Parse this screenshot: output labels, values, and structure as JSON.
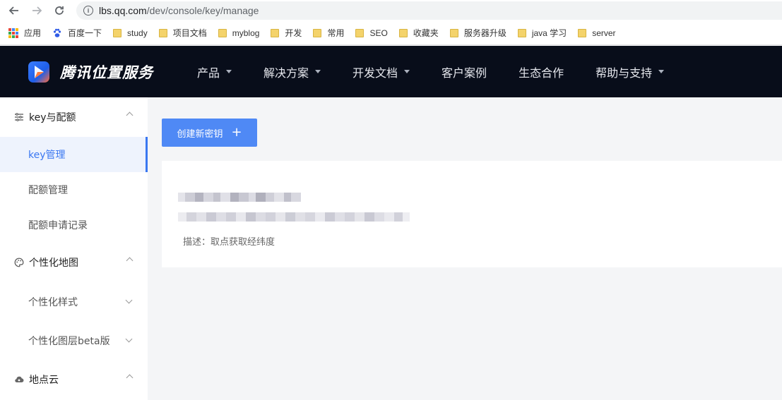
{
  "browser": {
    "url_host": "lbs.qq.com",
    "url_path": "/dev/console/key/manage",
    "bookmarks": [
      {
        "label": "应用",
        "icon": "apps-grid-icon"
      },
      {
        "label": "百度一下",
        "icon": "baidu-icon"
      },
      {
        "label": "study",
        "icon": "folder-icon"
      },
      {
        "label": "项目文档",
        "icon": "folder-icon"
      },
      {
        "label": "myblog",
        "icon": "folder-icon"
      },
      {
        "label": "开发",
        "icon": "folder-icon"
      },
      {
        "label": "常用",
        "icon": "folder-icon"
      },
      {
        "label": "SEO",
        "icon": "folder-icon"
      },
      {
        "label": "收藏夹",
        "icon": "folder-icon"
      },
      {
        "label": "服务器升级",
        "icon": "folder-icon"
      },
      {
        "label": "java 学习",
        "icon": "folder-icon"
      },
      {
        "label": "server",
        "icon": "folder-icon"
      }
    ]
  },
  "header": {
    "brand": "腾讯位置服务",
    "nav": [
      {
        "label": "产品",
        "dropdown": true
      },
      {
        "label": "解决方案",
        "dropdown": true
      },
      {
        "label": "开发文档",
        "dropdown": true
      },
      {
        "label": "客户案例",
        "dropdown": false
      },
      {
        "label": "生态合作",
        "dropdown": false
      },
      {
        "label": "帮助与支持",
        "dropdown": true
      }
    ]
  },
  "sidebar": {
    "group_key": "key与配额",
    "item_key_manage": "key管理",
    "item_quota_manage": "配额管理",
    "item_quota_apply": "配额申请记录",
    "group_map": "个性化地图",
    "item_custom_style": "个性化样式",
    "item_custom_layer": "个性化图层beta版",
    "group_place_cloud": "地点云"
  },
  "main": {
    "create_button": "创建新密钥",
    "create_plus": "+",
    "key_description": "描述：取点获取经纬度"
  },
  "colors": {
    "accent": "#3a77f1",
    "button": "#4f89f5",
    "header_bg": "#080d1a"
  }
}
